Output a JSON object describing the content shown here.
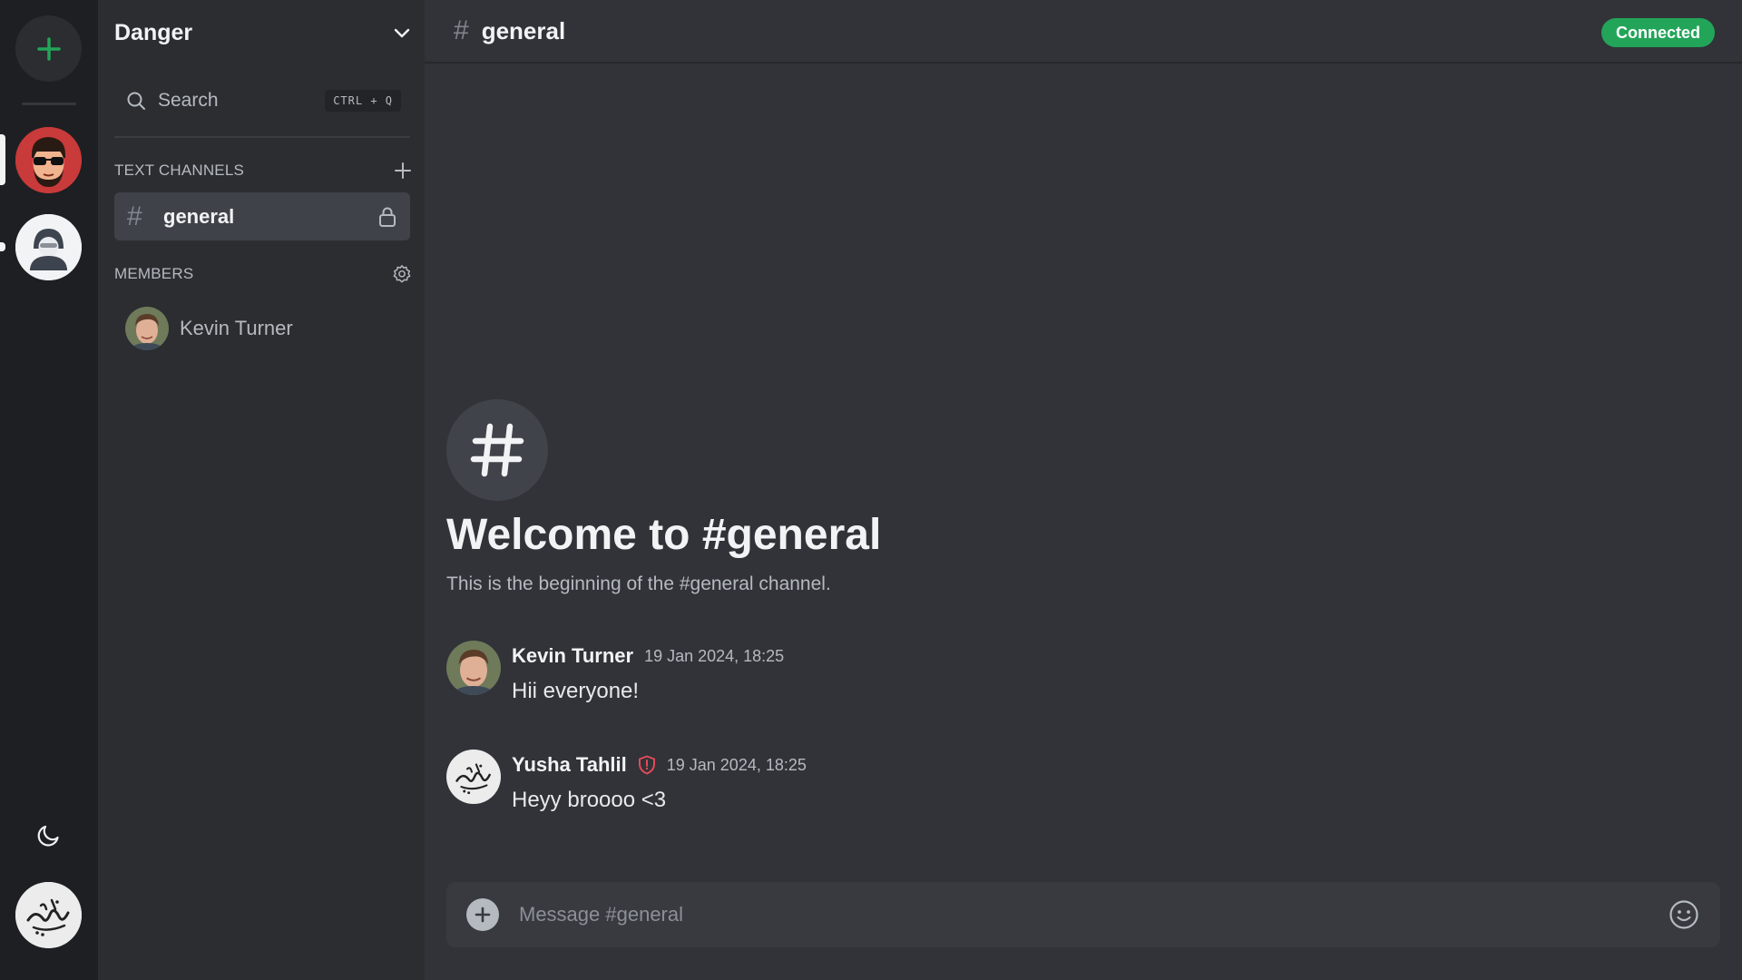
{
  "app": {
    "theme": "dark"
  },
  "colors": {
    "accent_green": "#23a559",
    "rail_bg": "#1e1f22",
    "sidebar_bg": "#2b2d31",
    "main_bg": "#313338",
    "moderator_red": "#e24a5a"
  },
  "rail": {
    "add_icon": "plus-icon",
    "servers": [
      {
        "icon": "avatar-man-sunglasses",
        "active": true
      },
      {
        "icon": "avatar-hacker",
        "active": false,
        "unread": true
      }
    ],
    "theme_icon": "moon-icon",
    "user_avatar": "avatar-calligraphy"
  },
  "sidebar": {
    "server_name": "Danger",
    "dropdown_icon": "chevron-down-icon",
    "search": {
      "label": "Search",
      "shortcut": "CTRL + Q"
    },
    "text_channels_label": "TEXT CHANNELS",
    "channels": [
      {
        "name": "general",
        "locked": true,
        "selected": true
      }
    ],
    "members_label": "MEMBERS",
    "members": [
      {
        "name": "Kevin Turner"
      }
    ]
  },
  "header": {
    "channel": "general",
    "status": "Connected"
  },
  "welcome": {
    "title": "Welcome to #general",
    "subtitle": "This is the beginning of the #general channel."
  },
  "messages": [
    {
      "author": "Kevin Turner",
      "time": "19 Jan 2024, 18:25",
      "text": "Hii everyone!",
      "moderator": false
    },
    {
      "author": "Yusha Tahlil",
      "time": "19 Jan 2024, 18:25",
      "text": "Heyy broooo <3",
      "moderator": true
    }
  ],
  "composer": {
    "placeholder": "Message #general"
  }
}
